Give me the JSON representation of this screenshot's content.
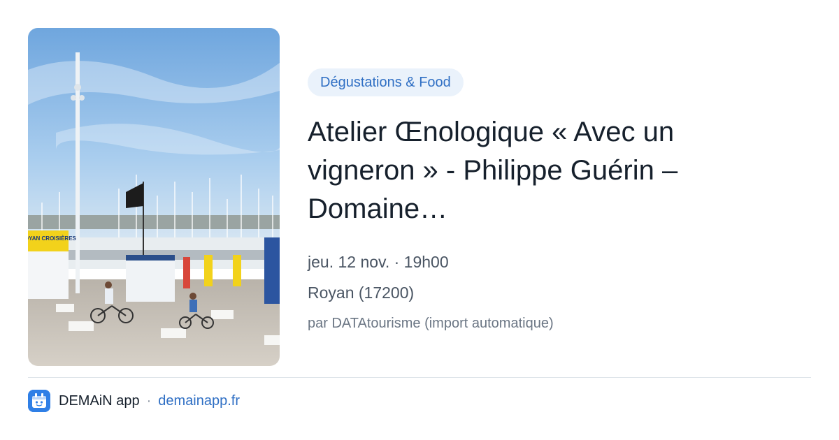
{
  "category_tag": "Dégustations & Food",
  "title": "Atelier Œnologique « Avec un vigneron » - Philippe Guérin – Domaine…",
  "date_time": "jeu. 12 nov. · 19h00",
  "location": "Royan (17200)",
  "source": "par DATAtourisme (import automatique)",
  "footer": {
    "brand": "DEMAiN app",
    "separator": "·",
    "site": "demainapp.fr",
    "logo_icon": "demain-calendar-icon"
  },
  "photo": {
    "subject": "harbor-marina-photo",
    "sign_text": "ROYAN CROISIÈRES",
    "colors": {
      "sky": "#8ebbe6",
      "ground": "#c9c2b8"
    }
  },
  "colors": {
    "accent": "#2f6fc4",
    "tag_bg": "#eaf2fb",
    "title": "#16202c"
  }
}
